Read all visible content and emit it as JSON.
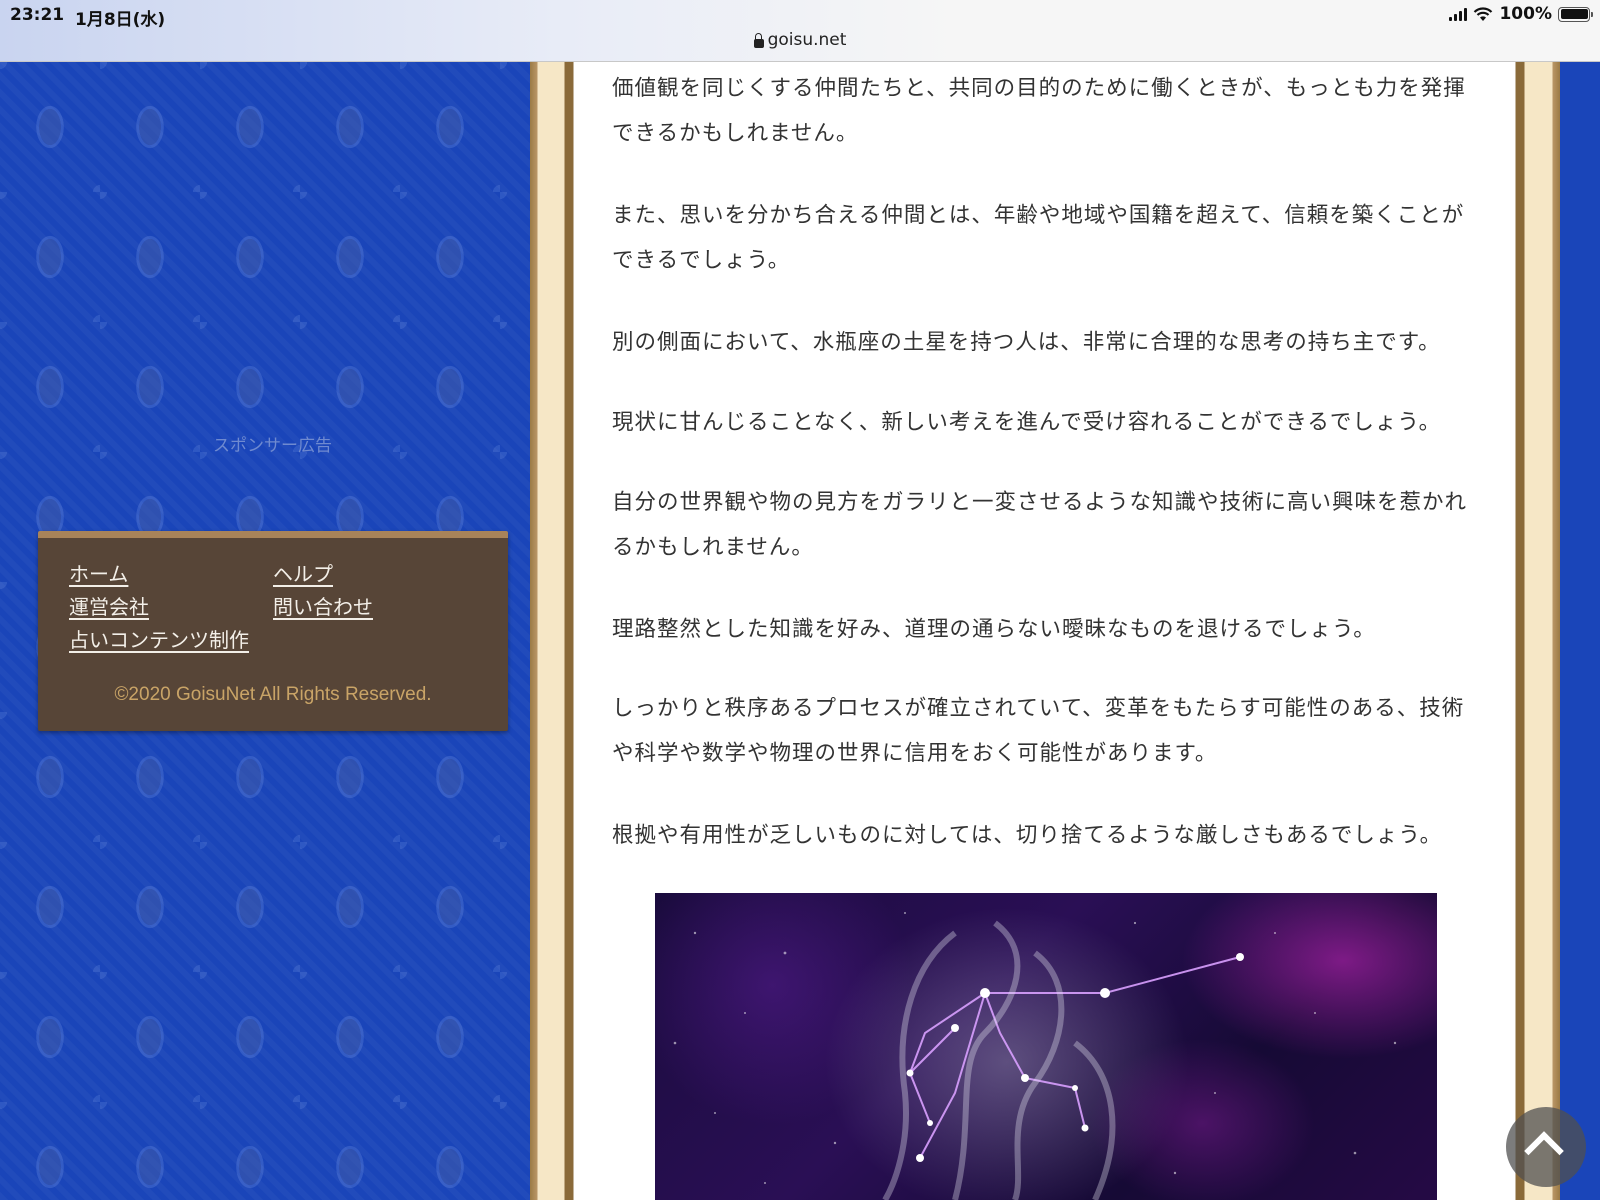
{
  "status_bar": {
    "time": "23:21",
    "date": "1月8日(水)",
    "battery": "100%"
  },
  "browser": {
    "url": "goisu.net"
  },
  "sidebar": {
    "sponsor_label": "スポンサー広告",
    "footer_links": {
      "home": "ホーム",
      "help": "ヘルプ",
      "company": "運営会社",
      "contact": "問い合わせ",
      "fortune": "占いコンテンツ制作"
    },
    "copyright": "©2020 GoisuNet All Rights Reserved."
  },
  "article": {
    "paragraphs": [
      "価値観を同じくする仲間たちと、共同の目的のために働くときが、もっとも力を発揮できるかもしれません。",
      "また、思いを分かち合える仲間とは、年齢や地域や国籍を超えて、信頼を築くことができるでしょう。",
      "別の側面において、水瓶座の土星を持つ人は、非常に合理的な思考の持ち主です。",
      "現状に甘んじることなく、新しい考えを進んで受け容れることができるでしょう。",
      "自分の世界観や物の見方をガラリと一変させるような知識や技術に高い興味を惹かれるかもしれません。",
      "理路整然とした知識を好み、道理の通らない曖昧なものを退けるでしょう。",
      "しっかりと秩序あるプロセスが確立されていて、変革をもたらす可能性のある、技術や科学や数学や物理の世界に信用をおく可能性があります。",
      "根拠や有用性が乏しいものに対しては、切り捨てるような厳しさもあるでしょう。"
    ]
  },
  "colors": {
    "damask_blue": "#1a45b9",
    "footer_brown": "#574537",
    "gold": "#c9a467",
    "frame_brown": "#8a6a39",
    "frame_cream": "#f6e7c6"
  },
  "icons": {
    "scroll_top": "chevron-up-icon",
    "lock": "lock-icon"
  }
}
